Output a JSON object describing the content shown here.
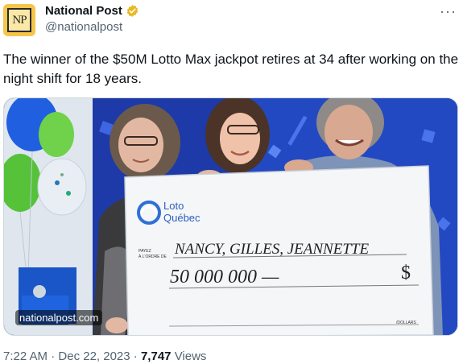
{
  "author": {
    "name": "National Post",
    "handle": "@nationalpost",
    "avatar_text": "NP",
    "verified_color": "#e8b923"
  },
  "tweet": {
    "text": "The winner of the $50M Lotto Max jackpot retires at 34 after working on the night shift for 18 years."
  },
  "media": {
    "source_tag": "nationalpost.com",
    "cheque": {
      "brand_line1": "Loto",
      "brand_line2": "Québec",
      "pay_to_line1": "PAYEZ",
      "pay_to_line2": "À L'ORDRE DE",
      "payee": "NANCY, GILLES, JEANNETTE",
      "amount": "50 000 000 —",
      "currency": "$",
      "dollars_label": "/DOLLARS"
    }
  },
  "meta": {
    "time": "7:22 AM",
    "date": "Dec 22, 2023",
    "views_count": "7,747",
    "views_label": "Views"
  },
  "menu_icon": "more-icon"
}
